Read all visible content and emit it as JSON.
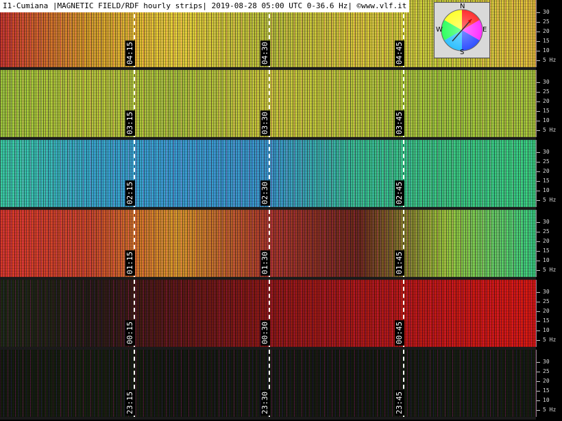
{
  "title": "I1-Cumiana |MAGNETIC FIELD/RDF hourly strips| 2019-08-28 05:00 UTC 0-36.6 Hz| ©www.vlf.it",
  "compass": {
    "n": "N",
    "s": "S",
    "e": "E",
    "w": "W"
  },
  "frequency_ticks": [
    "30",
    "25",
    "20",
    "15",
    "10",
    "5 Hz"
  ],
  "strips": [
    {
      "name": "strip-hour-04",
      "times": [
        "04:15",
        "04:30",
        "04:45"
      ],
      "colors": [
        "#c83a2a",
        "#d6a22a",
        "#e8d23a",
        "#b8c23a",
        "#d8c83a",
        "#c8d23a",
        "#e4c03a"
      ]
    },
    {
      "name": "strip-hour-03",
      "times": [
        "03:15",
        "03:30",
        "03:45"
      ],
      "colors": [
        "#9ec83a",
        "#b8c83a",
        "#a8c43a",
        "#c8c83a",
        "#b8c83a",
        "#9ec83a",
        "#a8c83a"
      ]
    },
    {
      "name": "strip-hour-02",
      "times": [
        "02:15",
        "02:30",
        "02:45"
      ],
      "colors": [
        "#3acfa0",
        "#38a8c8",
        "#3aa0d0",
        "#3a98c8",
        "#38c090",
        "#3ac880",
        "#3ad080"
      ]
    },
    {
      "name": "strip-hour-01",
      "times": [
        "01:15",
        "01:30",
        "01:45"
      ],
      "colors": [
        "#d83a28",
        "#c84a28",
        "#d89a2a",
        "#a83a28",
        "#6a2a1a",
        "#9ac83a",
        "#38d080"
      ]
    },
    {
      "name": "strip-hour-00",
      "times": [
        "00:15",
        "00:30",
        "00:45"
      ],
      "colors": [
        "#1e2a14",
        "#241e14",
        "#5a1a12",
        "#8a1a12",
        "#a81a14",
        "#c21a12",
        "#d81a10"
      ]
    },
    {
      "name": "strip-hour-23",
      "times": [
        "23:15",
        "23:30",
        "23:45"
      ],
      "colors": [
        "#141c0e",
        "#16200e",
        "#141a0e",
        "#161c10",
        "#141a0e",
        "#161e10",
        "#141c0e"
      ]
    }
  ]
}
